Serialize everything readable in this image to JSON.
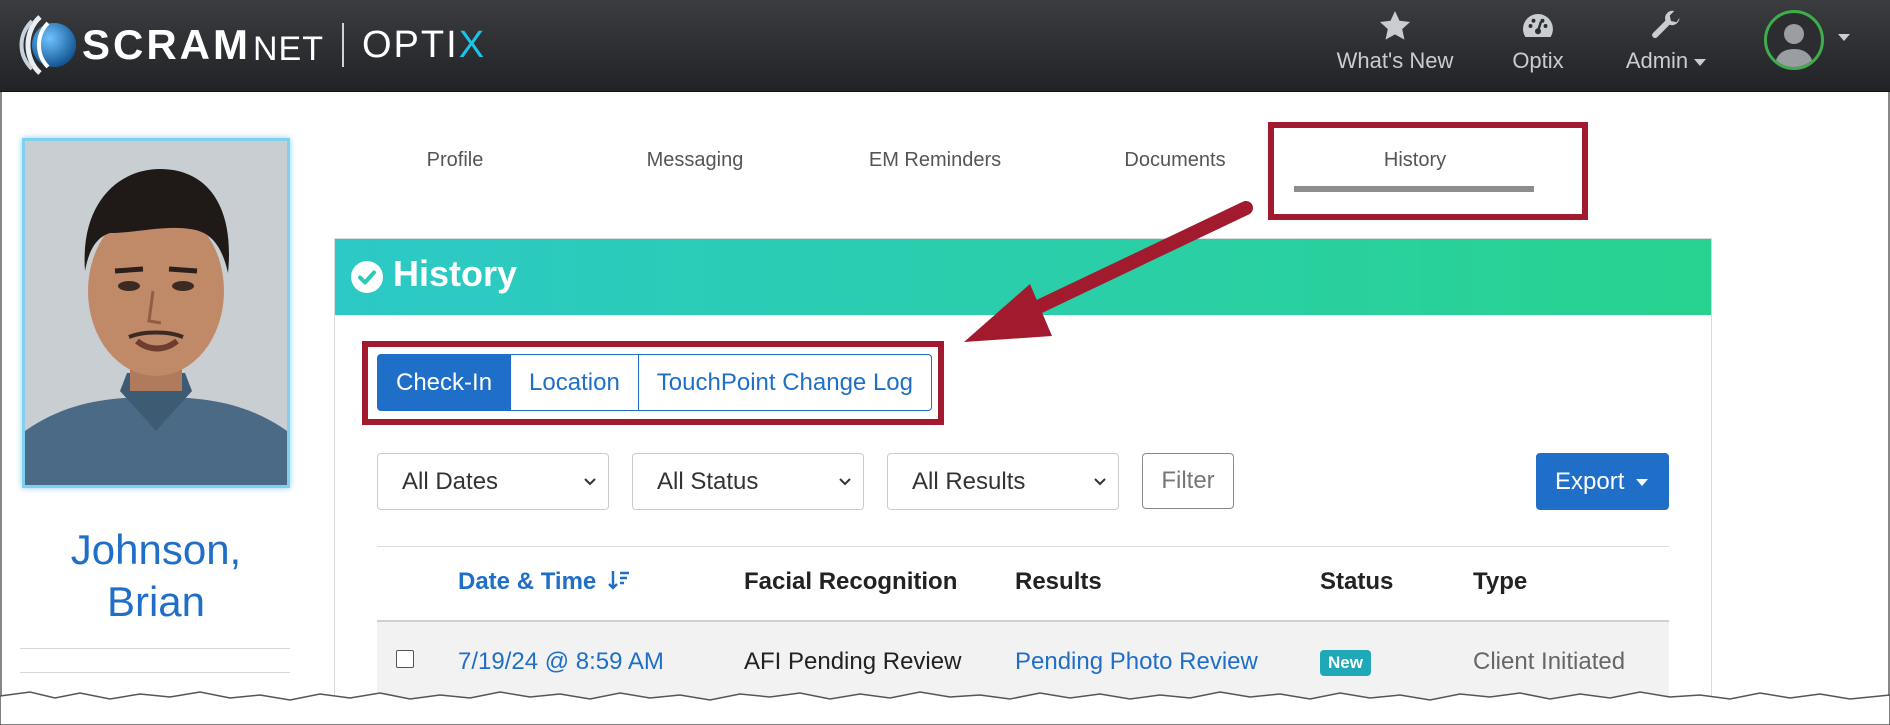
{
  "nav": {
    "brand": {
      "scram": "SCRAM",
      "net": "NET",
      "optix_prefix": "OPTI",
      "optix_x": "X"
    },
    "items": [
      {
        "label": "What's New",
        "icon": "star-icon"
      },
      {
        "label": "Optix",
        "icon": "gauge-icon"
      },
      {
        "label": "Admin",
        "icon": "wrench-icon"
      }
    ],
    "user_icon": "user-avatar-icon"
  },
  "client": {
    "last_name_line": "Johnson,",
    "first_name_line": "Brian"
  },
  "tabs": [
    {
      "label": "Profile"
    },
    {
      "label": "Messaging"
    },
    {
      "label": "EM Reminders"
    },
    {
      "label": "Documents"
    },
    {
      "label": "History",
      "active": true
    }
  ],
  "card": {
    "title": "History",
    "icon": "check-circle-icon"
  },
  "segments": [
    {
      "label": "Check-In",
      "active": true
    },
    {
      "label": "Location"
    },
    {
      "label": "TouchPoint Change Log"
    }
  ],
  "filters": {
    "dates": "All Dates",
    "status": "All Status",
    "results": "All Results",
    "filter_button": "Filter",
    "export_button": "Export"
  },
  "table": {
    "columns": {
      "date": "Date & Time",
      "facial": "Facial Recognition",
      "results": "Results",
      "status": "Status",
      "type": "Type"
    },
    "rows": [
      {
        "date": "7/19/24 @ 8:59 AM",
        "facial": "AFI Pending Review",
        "results": "Pending Photo Review",
        "status": "New",
        "type": "Client Initiated"
      }
    ]
  },
  "colors": {
    "brand_blue": "#1f6fc9",
    "highlight_red": "#a21a2d",
    "header_gradient_start": "#2cc9c6",
    "header_gradient_end": "#28d38f",
    "status_badge": "#1fa8b8"
  }
}
